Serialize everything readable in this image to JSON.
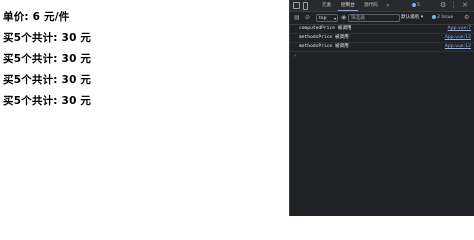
{
  "page": {
    "unit_price_line": "单价: 6 元/件",
    "buy_lines": [
      "买5个共计: 30 元",
      "买5个共计: 30 元",
      "买5个共计: 30 元",
      "买5个共计: 30 元"
    ]
  },
  "devtools": {
    "tabs": [
      "元素",
      "控制台",
      "源代码"
    ],
    "active_tab": "控制台",
    "more_label": "»",
    "badge_count": "5",
    "toolbar": {
      "context": "top",
      "filter_placeholder": "筛选器",
      "levels_label": "默认级别 ▾",
      "issues_label": "2 Issue"
    },
    "console_rows": [
      {
        "message": "computedPrice 被调用",
        "source": "App.vue:7"
      },
      {
        "message": "methodsPrice 被调用",
        "source": "App.vue:12"
      },
      {
        "message": "methodsPrice 被调用",
        "source": "App.vue:12"
      }
    ],
    "prompt": "›",
    "icons": [
      "inspect-icon",
      "device-toolbar-icon",
      "sidebar-icon",
      "clear-console-icon",
      "eye-icon",
      "gear-icon",
      "kebab-menu-icon",
      "close-icon"
    ]
  }
}
